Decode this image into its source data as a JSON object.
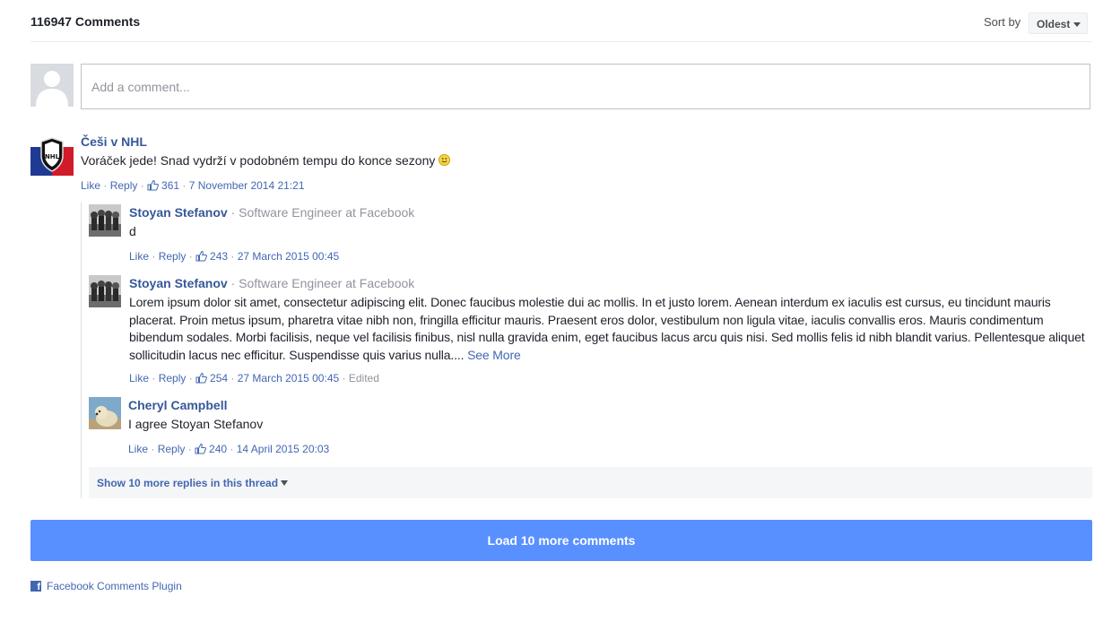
{
  "header": {
    "count_label": "116947 Comments",
    "sort_label": "Sort by",
    "sort_value": "Oldest"
  },
  "composer": {
    "placeholder": "Add a comment..."
  },
  "comments": [
    {
      "name": "Češi v NHL",
      "text": "Voráček jede! Snad vydrží v podobném tempu do konce sezony",
      "emoji": "smiley-emoji",
      "like": "Like",
      "reply": "Reply",
      "likes": "361",
      "time": "7 November 2014 21:21"
    }
  ],
  "replies": [
    {
      "name": "Stoyan Stefanov",
      "subtitle": "Software Engineer at Facebook",
      "text": "d",
      "like": "Like",
      "reply": "Reply",
      "likes": "243",
      "time": "27 March 2015 00:45"
    },
    {
      "name": "Stoyan Stefanov",
      "subtitle": "Software Engineer at Facebook",
      "text": "Lorem ipsum dolor sit amet, consectetur adipiscing elit. Donec faucibus molestie dui ac mollis. In et justo lorem. Aenean interdum ex iaculis est cursus, eu tincidunt mauris placerat. Proin metus ipsum, pharetra vitae nibh non, fringilla efficitur mauris. Praesent eros dolor, vestibulum non ligula vitae, iaculis convallis eros. Mauris condimentum bibendum sodales. Morbi facilisis, neque vel facilisis finibus, nisl nulla gravida enim, eget faucibus lacus arcu quis nisi. Sed mollis felis id nibh blandit varius. Pellentesque aliquet sollicitudin lacus nec efficitur. Suspendisse quis varius nulla....",
      "see_more": "See More",
      "like": "Like",
      "reply": "Reply",
      "likes": "254",
      "time": "27 March 2015 00:45",
      "edited": "Edited"
    },
    {
      "name": "Cheryl Campbell",
      "text": "I agree Stoyan Stefanov",
      "like": "Like",
      "reply": "Reply",
      "likes": "240",
      "time": "14 April 2015 20:03"
    }
  ],
  "more_replies_label": "Show 10 more replies in this thread",
  "load_more_label": "Load 10 more comments",
  "plugin_label": "Facebook Comments Plugin",
  "colors": {
    "link": "#4267b2",
    "name": "#365899",
    "load_button": "#5890ff",
    "muted": "#90949c"
  }
}
